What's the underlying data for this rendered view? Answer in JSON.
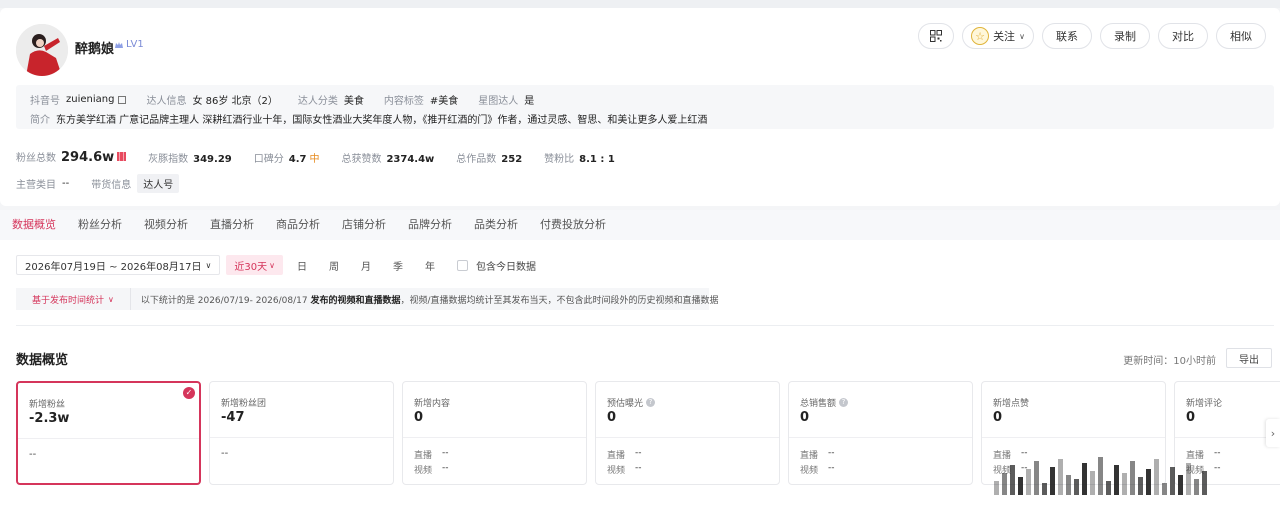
{
  "profile": {
    "nickname": "醉鹅娘",
    "level": "LV1",
    "info": {
      "douyin_id_label": "抖音号",
      "douyin_id": "zuieniang",
      "talent_info_label": "达人信息",
      "talent_info": "女 86岁 北京（2）",
      "category_label": "达人分类",
      "category": "美食",
      "content_tag_label": "内容标签",
      "content_tag": "#美食",
      "star_label": "星图达人",
      "star": "是",
      "intro_label": "简介",
      "intro": "东方美学红酒 广意记品牌主理人 深耕红酒行业十年，国际女性酒业大奖年度人物，《推开红酒的门》作者，通过灵感、智思、和美让更多人爱上红酒"
    },
    "stats": {
      "fans_label": "粉丝总数",
      "fans": "294.6w",
      "grey_label": "灰豚指数",
      "grey": "349.29",
      "reputation_label": "口碑分",
      "reputation": "4.7",
      "reputation_level": "中",
      "likes_label": "总获赞数",
      "likes": "2374.4w",
      "works_label": "总作品数",
      "works": "252",
      "ratio_label": "赞粉比",
      "ratio": "8.1 : 1"
    },
    "main_category_label": "主营类目",
    "main_category": "--",
    "goods_label": "带货信息",
    "goods_tag": "达人号"
  },
  "actions": {
    "follow": "关注",
    "contact": "联系",
    "record": "录制",
    "compare": "对比",
    "similar": "相似"
  },
  "tabs": [
    {
      "label": "数据概览"
    },
    {
      "label": "粉丝分析"
    },
    {
      "label": "视频分析"
    },
    {
      "label": "直播分析"
    },
    {
      "label": "商品分析"
    },
    {
      "label": "店铺分析"
    },
    {
      "label": "品牌分析"
    },
    {
      "label": "品类分析"
    },
    {
      "label": "付费投放分析"
    }
  ],
  "filters": {
    "date_range": "2026年07月19日 ~ 2026年08月17日",
    "preset": "近30天",
    "day": "日",
    "week": "周",
    "month": "月",
    "quarter": "季",
    "year": "年",
    "include_today": "包含今日数据"
  },
  "notice": {
    "selector": "基于发布时间统计",
    "prefix": "以下统计的是 2026/07/19- 2026/08/17 ",
    "bold": "发布的视频和直播数据",
    "suffix": "，视频/直播数据均统计至其发布当天，不包含此时间段外的历史视频和直播数据"
  },
  "overview": {
    "title": "数据概览",
    "update_time": "更新时间：10小时前",
    "export": "导出",
    "live_label": "直播",
    "video_label": "视频",
    "dash": "--",
    "cards": [
      {
        "label": "新增粉丝",
        "value": "-2.3w",
        "detail": "--"
      },
      {
        "label": "新增粉丝团",
        "value": "-47",
        "detail": "--"
      },
      {
        "label": "新增内容",
        "value": "0",
        "live": "--",
        "video": "--"
      },
      {
        "label": "预估曝光",
        "value": "0",
        "live": "--",
        "video": "--"
      },
      {
        "label": "总销售额",
        "value": "0",
        "live": "--",
        "video": "--"
      },
      {
        "label": "新增点赞",
        "value": "0",
        "live": "--",
        "video": "--"
      },
      {
        "label": "新增评论",
        "value": "0",
        "live": "--",
        "video": "--"
      }
    ]
  },
  "colors": {
    "accent": "#d5355b",
    "active_chip_bg": "#fde8ee",
    "reputation_mid": "#e68a1e"
  }
}
